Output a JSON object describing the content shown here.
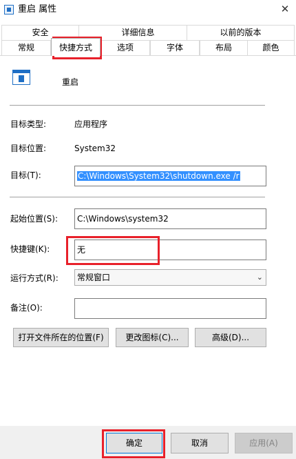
{
  "window": {
    "title": "重启 属性",
    "close_glyph": "✕"
  },
  "tabs": {
    "row1": [
      "安全",
      "详细信息",
      "以前的版本"
    ],
    "row2": [
      "常规",
      "快捷方式",
      "选项",
      "字体",
      "布局",
      "颜色"
    ],
    "active": "快捷方式"
  },
  "header": {
    "name": "重启"
  },
  "fields": {
    "target_type_label": "目标类型:",
    "target_type_value": "应用程序",
    "target_location_label": "目标位置:",
    "target_location_value": "System32",
    "target_label": "目标(T):",
    "target_value": "C:\\Windows\\System32\\shutdown.exe /r",
    "start_in_label": "起始位置(S):",
    "start_in_value": "C:\\Windows\\system32",
    "shortcut_key_label": "快捷键(K):",
    "shortcut_key_value": "无",
    "run_label": "运行方式(R):",
    "run_value": "常规窗口",
    "comment_label": "备注(O):",
    "comment_value": ""
  },
  "actions": {
    "open_location": "打开文件所在的位置(F)",
    "change_icon": "更改图标(C)...",
    "advanced": "高级(D)..."
  },
  "footer": {
    "ok": "确定",
    "cancel": "取消",
    "apply": "应用(A)"
  },
  "colors": {
    "highlight_box": "#e8202a",
    "selection": "#3390ff"
  }
}
